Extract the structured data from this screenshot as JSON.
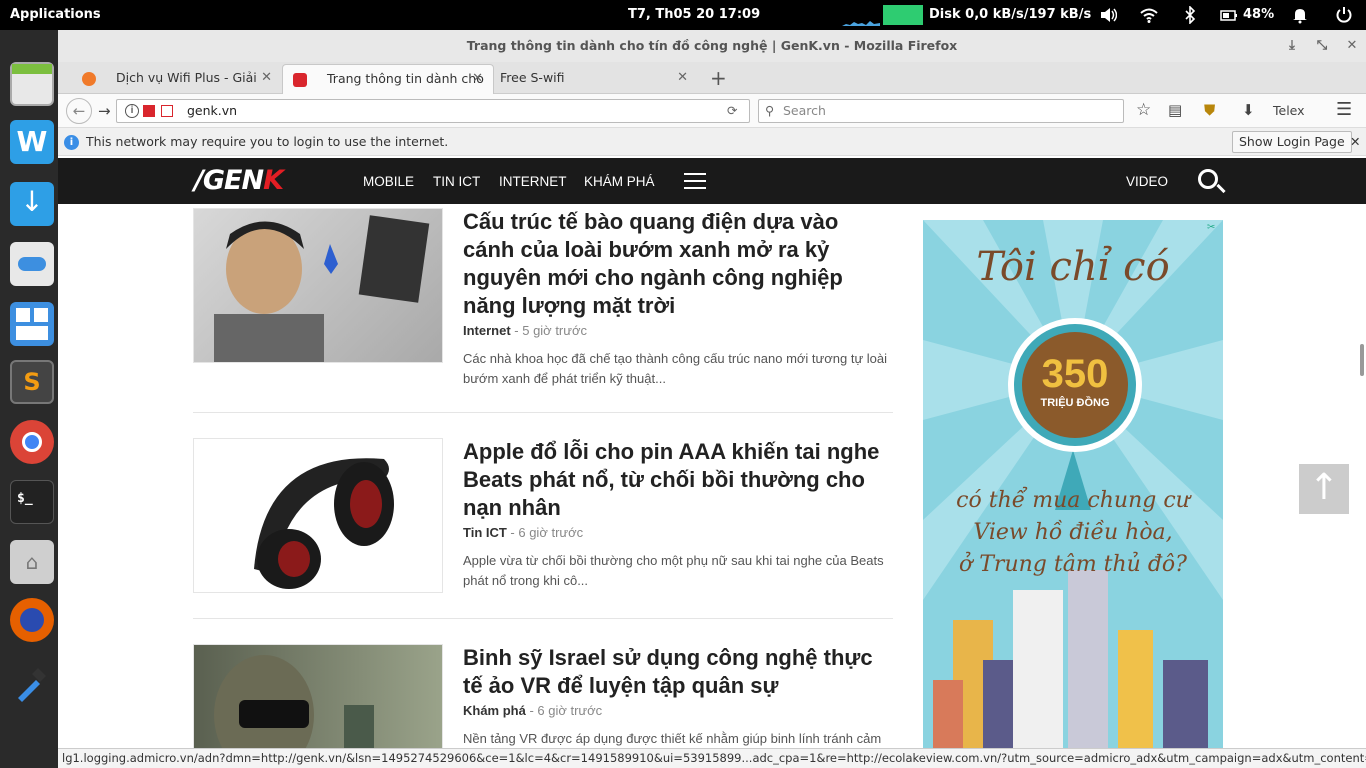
{
  "panel": {
    "applications": "Applications",
    "clock": "T7, Th05 20     17:09",
    "disk": "Disk 0,0 kB/s/197 kB/s",
    "battery": "48%"
  },
  "window": {
    "title": "Trang thông tin dành cho tín đồ công nghệ | GenK.vn - Mozilla Firefox"
  },
  "tabs": [
    {
      "label": "Dịch vụ Wifi Plus - Giải ph...",
      "favicon_color": "#f07a2a"
    },
    {
      "label": "Trang thông tin dành cho ...",
      "favicon_color": "#d9262d"
    },
    {
      "label": "Free S-wifi",
      "favicon_color": ""
    }
  ],
  "navbar": {
    "url": "genk.vn",
    "search_placeholder": "Search",
    "ime": "Telex"
  },
  "infobar": {
    "message": "This network may require you to login to use the internet.",
    "button": "Show Login Page"
  },
  "site": {
    "logo_slash": "/GEN",
    "logo_k": "K",
    "nav": [
      "MOBILE",
      "TIN ICT",
      "INTERNET",
      "KHÁM PHÁ"
    ],
    "video": "VIDEO"
  },
  "articles": [
    {
      "title": "Cấu trúc tế bào quang điện dựa vào cánh của loài bướm xanh mở ra kỷ nguyên mới cho ngành công nghiệp năng lượng mặt trời",
      "category": "Internet",
      "time": " - 5 giờ trước",
      "desc": "Các nhà khoa học đã chế tạo thành công cấu trúc nano mới tương tự loài bướm xanh để phát triển kỹ thuật..."
    },
    {
      "title": "Apple đổ lỗi cho pin AAA khiến tai nghe Beats phát nổ, từ chối bồi thường cho nạn nhân",
      "category": "Tin ICT",
      "time": " - 6 giờ trước",
      "desc": "Apple vừa từ chối bồi thường cho một phụ nữ sau khi tai nghe của Beats phát nổ trong khi cô..."
    },
    {
      "title": "Binh sỹ Israel sử dụng công nghệ thực tế ảo VR để luyện tập quân sự",
      "category": "Khám phá",
      "time": " - 6 giờ trước",
      "desc": "Nền tảng VR được áp dụng được thiết kế nhằm giúp binh lính tránh cảm"
    }
  ],
  "ad": {
    "headline": "Tôi chỉ có",
    "amount": "350",
    "unit": "TRIỆU ĐỒNG",
    "line1": "có thể mua chung cư",
    "line2": "View hồ điều hòa,",
    "line3": "ở Trung tâm thủ đô?"
  },
  "statusbar": "lg1.logging.admicro.vn/adn?dmn=http://genk.vn/&lsn=1495274529606&ce=1&lc=4&cr=1491589910&ui=53915899...adc_cpa=1&re=http://ecolakeview.com.vn/?utm_source=admicro_adx&utm_campaign=adx&utm_content=genk.vn"
}
